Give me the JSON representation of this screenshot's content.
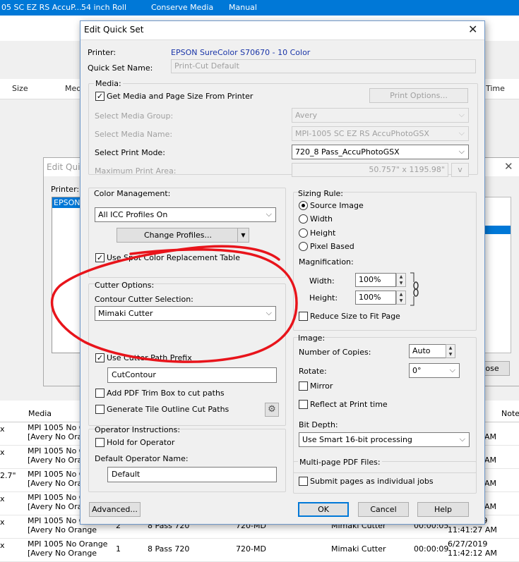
{
  "background": {
    "top_row": [
      "05 SC EZ RS AccuP...",
      "54 inch Roll",
      "Conserve Media",
      "Manual"
    ],
    "header": {
      "size": "Size",
      "med": "Med",
      "time": "Time"
    },
    "dialog": {
      "title": "Edit Quic",
      "printer_label": "Printer:",
      "printer_item": "EPSON",
      "partial_button": "ose"
    },
    "list_header": {
      "media": "Media",
      "notes": "Note"
    },
    "rows": [
      {
        "a": "x",
        "media1": "MPI 1005 No Oran",
        "media2": "[Avery No Oran",
        "time": "AM"
      },
      {
        "a": "x",
        "media1": "MPI 1005 No Oran",
        "media2": "[Avery No Oran",
        "time": "AM"
      },
      {
        "a": "2.7\"",
        "media1": "MPI 1005 No Oran",
        "media2": "[Avery No Oran",
        "time": "AM"
      },
      {
        "a": "x",
        "media1": "MPI 1005 No Oran",
        "media2": "[Avery No Oran",
        "time": "AM"
      },
      {
        "a": "x",
        "media1": "MPI 1005 No Orange",
        "media2": "[Avery No Orange",
        "copies": "2",
        "mode": "8 Pass 720",
        "mode2": "720-MD",
        "cutter": "Mimaki Cutter",
        "dur": "00:00:05",
        "date": "6/27/2019",
        "time": "11:41:27 AM"
      },
      {
        "a": "x",
        "media1": "MPI 1005 No Orange",
        "media2": "[Avery No Orange",
        "copies": "1",
        "mode": "8 Pass 720",
        "mode2": "720-MD",
        "cutter": "Mimaki Cutter",
        "dur": "00:00:09",
        "date": "6/27/2019",
        "time": "11:42:12 AM"
      }
    ]
  },
  "dialog": {
    "title": "Edit Quick Set",
    "printer_label": "Printer:",
    "printer_value": "EPSON SureColor S70670 - 10 Color",
    "quickset_label": "Quick Set Name:",
    "quickset_value": "Print-Cut Default",
    "media": {
      "group": "Media:",
      "get_from_printer": "Get Media and Page Size From Printer",
      "print_options": "Print Options...",
      "media_group_label": "Select Media Group:",
      "media_group_value": "Avery",
      "media_name_label": "Select Media Name:",
      "media_name_value": "MPI-1005 SC EZ RS AccuPhotoGSX",
      "print_mode_label": "Select Print Mode:",
      "print_mode_value": "720_8 Pass_AccuPhotoGSX",
      "max_area_label": "Maximum Print Area:",
      "max_area_value": "50.757\" x 1195.98\"",
      "units": "v"
    },
    "color": {
      "group": "Color Management:",
      "profiles_value": "All ICC Profiles On",
      "change_profiles": "Change Profiles...",
      "spot_color": "Use Spot Color Replacement Table"
    },
    "cutter": {
      "group": "Cutter Options:",
      "contour_label": "Contour Cutter Selection:",
      "contour_value": "Mimaki Cutter",
      "use_prefix": "Use Cutter Path Prefix",
      "prefix_value": "CutContour",
      "trim_box": "Add PDF Trim Box to cut paths",
      "tile_outline": "Generate Tile Outline Cut Paths"
    },
    "operator": {
      "group": "Operator Instructions:",
      "hold": "Hold for Operator",
      "name_label": "Default Operator Name:",
      "name_value": "Default"
    },
    "sizing": {
      "group": "Sizing Rule:",
      "options": [
        "Source Image",
        "Width",
        "Height",
        "Pixel Based"
      ],
      "selected": "Source Image",
      "magnification": "Magnification:",
      "width_label": "Width:",
      "width_value": "100%",
      "height_label": "Height:",
      "height_value": "100%",
      "reduce": "Reduce Size to Fit Page"
    },
    "image": {
      "group": "Image:",
      "copies_label": "Number of Copies:",
      "copies_value": "Auto",
      "rotate_label": "Rotate:",
      "rotate_value": "0°",
      "mirror": "Mirror",
      "reflect": "Reflect at Print time",
      "bitdepth_label": "Bit Depth:",
      "bitdepth_value": "Use Smart 16-bit processing"
    },
    "multipage": {
      "group": "Multi-page PDF Files:",
      "submit": "Submit pages as individual jobs"
    },
    "buttons": {
      "advanced": "Advanced...",
      "ok": "OK",
      "cancel": "Cancel",
      "help": "Help"
    }
  },
  "colors": {
    "selection": "#0078d7",
    "annotation": "#e8141b",
    "printer_text": "#1a35a8"
  }
}
